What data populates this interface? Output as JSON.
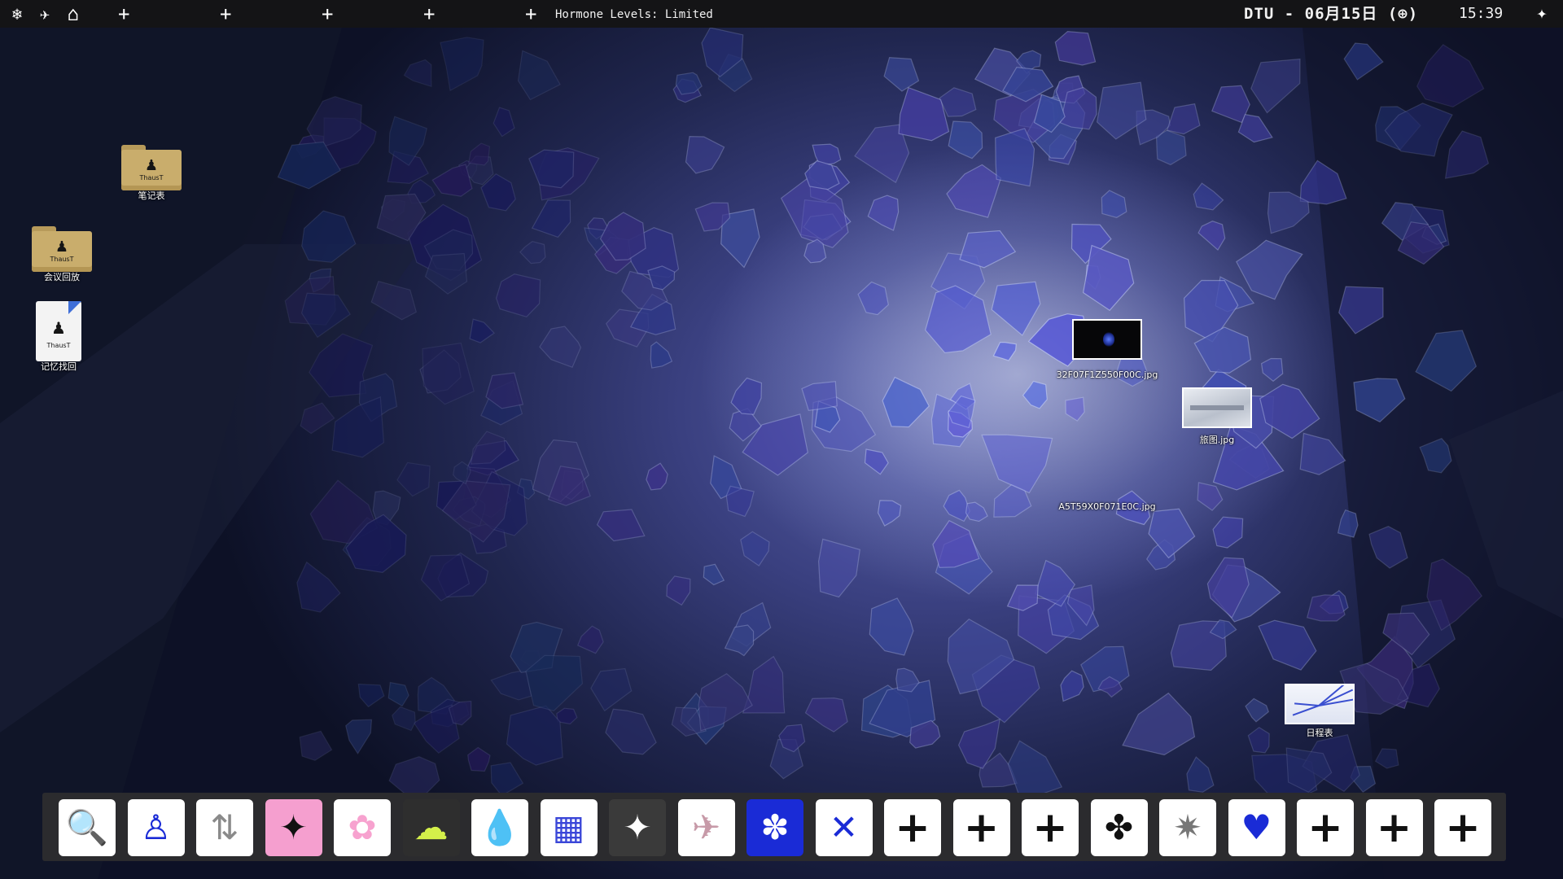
{
  "topbar": {
    "left_icons": [
      {
        "name": "snowflake-icon",
        "glyph": "❄"
      },
      {
        "name": "paper-plane-icon",
        "glyph": "✈"
      },
      {
        "name": "home-icon",
        "glyph": "⌂"
      }
    ],
    "plus_glyph": "+",
    "hormone_text": "Hormone Levels: Limited",
    "date_text": "DTU - 06月15日 (⊕)",
    "time_text": "15:39",
    "sparkle_glyph": "✦"
  },
  "desktop": {
    "folder_brand_glyph": "♟",
    "folder_brand_text": "ThausT",
    "icons": {
      "notebook_label": "笔记表",
      "meeting_label": "会议回放",
      "memory_label": "记忆找回",
      "image1_label": "32F07F1Z550F00C.jpg",
      "image2_label": "旅图.jpg",
      "image3_label": "A5T59X0F071E0C.jpg",
      "diary_label": "日程表"
    }
  },
  "dock": {
    "items": [
      {
        "name": "search-document-icon",
        "glyph": "🔍",
        "bg": "#ffffff",
        "fg": "#1a2bd6"
      },
      {
        "name": "angel-figure-icon",
        "glyph": "♙",
        "bg": "#ffffff",
        "fg": "#1a2bd6"
      },
      {
        "name": "transfer-arrows-icon",
        "glyph": "⇅",
        "bg": "#ffffff",
        "fg": "#8a8a8a"
      },
      {
        "name": "sparkle-icon",
        "glyph": "✦",
        "bg": "#f59fcf",
        "fg": "#111111"
      },
      {
        "name": "flower-icon",
        "glyph": "✿",
        "bg": "#ffffff",
        "fg": "#f7a2cf"
      },
      {
        "name": "cloud-icon",
        "glyph": "☁",
        "bg": "#2e2e2e",
        "fg": "#d4f04a"
      },
      {
        "name": "water-drop-icon",
        "glyph": "💧",
        "bg": "#ffffff",
        "fg": "#1a2bd6"
      },
      {
        "name": "checkered-pattern-icon",
        "glyph": "▦",
        "bg": "#ffffff",
        "fg": "#3a46d8"
      },
      {
        "name": "star-icon",
        "glyph": "✦",
        "bg": "#3a3a3a",
        "fg": "#ffffff"
      },
      {
        "name": "paper-plane-icon",
        "glyph": "✈",
        "bg": "#ffffff",
        "fg": "#c79aa8"
      },
      {
        "name": "asterisk-flower-icon",
        "glyph": "✽",
        "bg": "#1a2bd6",
        "fg": "#ffffff"
      },
      {
        "name": "crossed-lines-icon",
        "glyph": "✕",
        "bg": "#ffffff",
        "fg": "#1a2bd6"
      },
      {
        "name": "add-icon",
        "glyph": "+",
        "bg": "#ffffff",
        "fg": "#111111"
      },
      {
        "name": "add-icon",
        "glyph": "+",
        "bg": "#ffffff",
        "fg": "#111111"
      },
      {
        "name": "add-icon",
        "glyph": "+",
        "bg": "#ffffff",
        "fg": "#111111"
      },
      {
        "name": "propeller-icon",
        "glyph": "✤",
        "bg": "#ffffff",
        "fg": "#111111"
      },
      {
        "name": "burst-star-icon",
        "glyph": "✷",
        "bg": "#ffffff",
        "fg": "#777777"
      },
      {
        "name": "heart-icon",
        "glyph": "♥",
        "bg": "#ffffff",
        "fg": "#1a2bd6"
      },
      {
        "name": "add-icon",
        "glyph": "+",
        "bg": "#ffffff",
        "fg": "#111111"
      },
      {
        "name": "add-icon",
        "glyph": "+",
        "bg": "#ffffff",
        "fg": "#111111"
      },
      {
        "name": "add-icon",
        "glyph": "+",
        "bg": "#ffffff",
        "fg": "#111111"
      }
    ]
  }
}
